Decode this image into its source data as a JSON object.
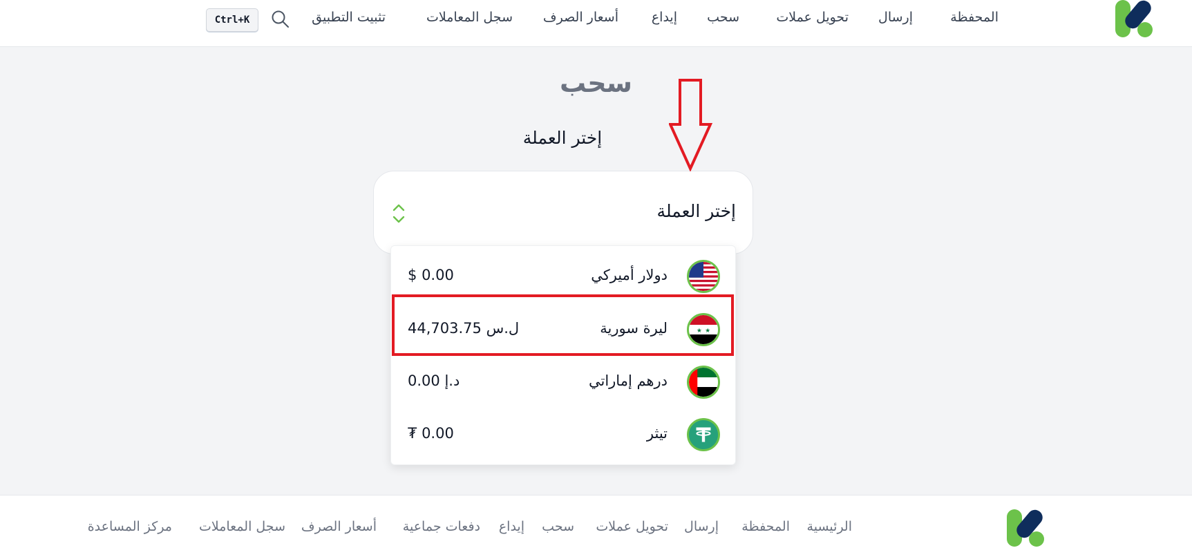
{
  "header": {
    "nav": [
      {
        "label": "المحفظة"
      },
      {
        "label": "إرسال"
      },
      {
        "label": "تحويل عملات"
      },
      {
        "label": "سحب"
      },
      {
        "label": "إيداع"
      },
      {
        "label": "أسعار الصرف"
      },
      {
        "label": "سجل المعاملات"
      },
      {
        "label": "تثبيت التطبيق"
      }
    ],
    "search_shortcut": "Ctrl+K",
    "search_icon": "search-icon"
  },
  "main": {
    "title": "سحب",
    "select_label": "إختر العملة",
    "select_value": "إختر العملة",
    "options": [
      {
        "name": "دولار أميركي",
        "amount": "0.00",
        "symbol": "$",
        "flag": "us-flag-icon"
      },
      {
        "name": "ليرة سورية",
        "amount": "44,703.75",
        "symbol": "ل.س",
        "flag": "syria-flag-icon"
      },
      {
        "name": "درهم إماراتي",
        "amount": "0.00",
        "symbol": "د.إ",
        "flag": "uae-flag-icon"
      },
      {
        "name": "تيثر",
        "amount": "0.00",
        "symbol": "₮",
        "flag": "tether-icon"
      }
    ],
    "highlighted_option_index": 1
  },
  "footer": {
    "links": [
      {
        "label": "الرئيسية"
      },
      {
        "label": "المحفظة"
      },
      {
        "label": "إرسال"
      },
      {
        "label": "تحويل عملات"
      },
      {
        "label": "سحب"
      },
      {
        "label": "إيداع"
      },
      {
        "label": "دفعات جماعية"
      },
      {
        "label": "أسعار الصرف"
      },
      {
        "label": "سجل المعاملات"
      },
      {
        "label": "مركز المساعدة"
      }
    ]
  },
  "colors": {
    "brand_green": "#6cc24a",
    "brand_navy": "#0f2d5c",
    "annotation_red": "#e31b23"
  }
}
